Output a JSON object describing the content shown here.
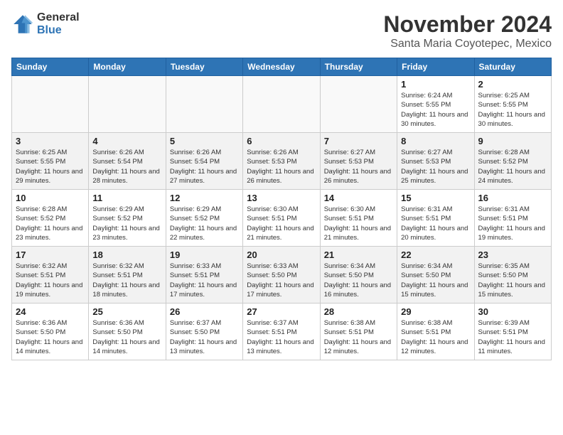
{
  "logo": {
    "general": "General",
    "blue": "Blue"
  },
  "header": {
    "month": "November 2024",
    "location": "Santa Maria Coyotepec, Mexico"
  },
  "weekdays": [
    "Sunday",
    "Monday",
    "Tuesday",
    "Wednesday",
    "Thursday",
    "Friday",
    "Saturday"
  ],
  "weeks": [
    [
      {
        "day": "",
        "info": ""
      },
      {
        "day": "",
        "info": ""
      },
      {
        "day": "",
        "info": ""
      },
      {
        "day": "",
        "info": ""
      },
      {
        "day": "",
        "info": ""
      },
      {
        "day": "1",
        "info": "Sunrise: 6:24 AM\nSunset: 5:55 PM\nDaylight: 11 hours and 30 minutes."
      },
      {
        "day": "2",
        "info": "Sunrise: 6:25 AM\nSunset: 5:55 PM\nDaylight: 11 hours and 30 minutes."
      }
    ],
    [
      {
        "day": "3",
        "info": "Sunrise: 6:25 AM\nSunset: 5:55 PM\nDaylight: 11 hours and 29 minutes."
      },
      {
        "day": "4",
        "info": "Sunrise: 6:26 AM\nSunset: 5:54 PM\nDaylight: 11 hours and 28 minutes."
      },
      {
        "day": "5",
        "info": "Sunrise: 6:26 AM\nSunset: 5:54 PM\nDaylight: 11 hours and 27 minutes."
      },
      {
        "day": "6",
        "info": "Sunrise: 6:26 AM\nSunset: 5:53 PM\nDaylight: 11 hours and 26 minutes."
      },
      {
        "day": "7",
        "info": "Sunrise: 6:27 AM\nSunset: 5:53 PM\nDaylight: 11 hours and 26 minutes."
      },
      {
        "day": "8",
        "info": "Sunrise: 6:27 AM\nSunset: 5:53 PM\nDaylight: 11 hours and 25 minutes."
      },
      {
        "day": "9",
        "info": "Sunrise: 6:28 AM\nSunset: 5:52 PM\nDaylight: 11 hours and 24 minutes."
      }
    ],
    [
      {
        "day": "10",
        "info": "Sunrise: 6:28 AM\nSunset: 5:52 PM\nDaylight: 11 hours and 23 minutes."
      },
      {
        "day": "11",
        "info": "Sunrise: 6:29 AM\nSunset: 5:52 PM\nDaylight: 11 hours and 23 minutes."
      },
      {
        "day": "12",
        "info": "Sunrise: 6:29 AM\nSunset: 5:52 PM\nDaylight: 11 hours and 22 minutes."
      },
      {
        "day": "13",
        "info": "Sunrise: 6:30 AM\nSunset: 5:51 PM\nDaylight: 11 hours and 21 minutes."
      },
      {
        "day": "14",
        "info": "Sunrise: 6:30 AM\nSunset: 5:51 PM\nDaylight: 11 hours and 21 minutes."
      },
      {
        "day": "15",
        "info": "Sunrise: 6:31 AM\nSunset: 5:51 PM\nDaylight: 11 hours and 20 minutes."
      },
      {
        "day": "16",
        "info": "Sunrise: 6:31 AM\nSunset: 5:51 PM\nDaylight: 11 hours and 19 minutes."
      }
    ],
    [
      {
        "day": "17",
        "info": "Sunrise: 6:32 AM\nSunset: 5:51 PM\nDaylight: 11 hours and 19 minutes."
      },
      {
        "day": "18",
        "info": "Sunrise: 6:32 AM\nSunset: 5:51 PM\nDaylight: 11 hours and 18 minutes."
      },
      {
        "day": "19",
        "info": "Sunrise: 6:33 AM\nSunset: 5:51 PM\nDaylight: 11 hours and 17 minutes."
      },
      {
        "day": "20",
        "info": "Sunrise: 6:33 AM\nSunset: 5:50 PM\nDaylight: 11 hours and 17 minutes."
      },
      {
        "day": "21",
        "info": "Sunrise: 6:34 AM\nSunset: 5:50 PM\nDaylight: 11 hours and 16 minutes."
      },
      {
        "day": "22",
        "info": "Sunrise: 6:34 AM\nSunset: 5:50 PM\nDaylight: 11 hours and 15 minutes."
      },
      {
        "day": "23",
        "info": "Sunrise: 6:35 AM\nSunset: 5:50 PM\nDaylight: 11 hours and 15 minutes."
      }
    ],
    [
      {
        "day": "24",
        "info": "Sunrise: 6:36 AM\nSunset: 5:50 PM\nDaylight: 11 hours and 14 minutes."
      },
      {
        "day": "25",
        "info": "Sunrise: 6:36 AM\nSunset: 5:50 PM\nDaylight: 11 hours and 14 minutes."
      },
      {
        "day": "26",
        "info": "Sunrise: 6:37 AM\nSunset: 5:50 PM\nDaylight: 11 hours and 13 minutes."
      },
      {
        "day": "27",
        "info": "Sunrise: 6:37 AM\nSunset: 5:51 PM\nDaylight: 11 hours and 13 minutes."
      },
      {
        "day": "28",
        "info": "Sunrise: 6:38 AM\nSunset: 5:51 PM\nDaylight: 11 hours and 12 minutes."
      },
      {
        "day": "29",
        "info": "Sunrise: 6:38 AM\nSunset: 5:51 PM\nDaylight: 11 hours and 12 minutes."
      },
      {
        "day": "30",
        "info": "Sunrise: 6:39 AM\nSunset: 5:51 PM\nDaylight: 11 hours and 11 minutes."
      }
    ]
  ]
}
